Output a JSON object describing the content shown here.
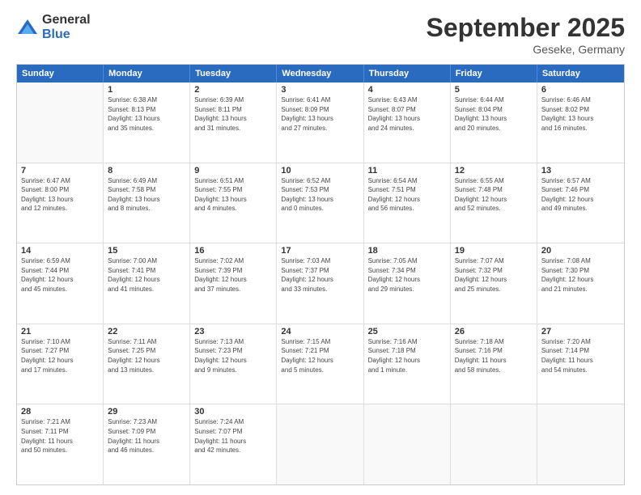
{
  "logo": {
    "general": "General",
    "blue": "Blue"
  },
  "title": {
    "month": "September 2025",
    "location": "Geseke, Germany"
  },
  "header": {
    "days": [
      "Sunday",
      "Monday",
      "Tuesday",
      "Wednesday",
      "Thursday",
      "Friday",
      "Saturday"
    ]
  },
  "weeks": [
    [
      {
        "day": "",
        "empty": true
      },
      {
        "day": "1",
        "info": "Sunrise: 6:38 AM\nSunset: 8:13 PM\nDaylight: 13 hours\nand 35 minutes."
      },
      {
        "day": "2",
        "info": "Sunrise: 6:39 AM\nSunset: 8:11 PM\nDaylight: 13 hours\nand 31 minutes."
      },
      {
        "day": "3",
        "info": "Sunrise: 6:41 AM\nSunset: 8:09 PM\nDaylight: 13 hours\nand 27 minutes."
      },
      {
        "day": "4",
        "info": "Sunrise: 6:43 AM\nSunset: 8:07 PM\nDaylight: 13 hours\nand 24 minutes."
      },
      {
        "day": "5",
        "info": "Sunrise: 6:44 AM\nSunset: 8:04 PM\nDaylight: 13 hours\nand 20 minutes."
      },
      {
        "day": "6",
        "info": "Sunrise: 6:46 AM\nSunset: 8:02 PM\nDaylight: 13 hours\nand 16 minutes."
      }
    ],
    [
      {
        "day": "7",
        "info": "Sunrise: 6:47 AM\nSunset: 8:00 PM\nDaylight: 13 hours\nand 12 minutes."
      },
      {
        "day": "8",
        "info": "Sunrise: 6:49 AM\nSunset: 7:58 PM\nDaylight: 13 hours\nand 8 minutes."
      },
      {
        "day": "9",
        "info": "Sunrise: 6:51 AM\nSunset: 7:55 PM\nDaylight: 13 hours\nand 4 minutes."
      },
      {
        "day": "10",
        "info": "Sunrise: 6:52 AM\nSunset: 7:53 PM\nDaylight: 13 hours\nand 0 minutes."
      },
      {
        "day": "11",
        "info": "Sunrise: 6:54 AM\nSunset: 7:51 PM\nDaylight: 12 hours\nand 56 minutes."
      },
      {
        "day": "12",
        "info": "Sunrise: 6:55 AM\nSunset: 7:48 PM\nDaylight: 12 hours\nand 52 minutes."
      },
      {
        "day": "13",
        "info": "Sunrise: 6:57 AM\nSunset: 7:46 PM\nDaylight: 12 hours\nand 49 minutes."
      }
    ],
    [
      {
        "day": "14",
        "info": "Sunrise: 6:59 AM\nSunset: 7:44 PM\nDaylight: 12 hours\nand 45 minutes."
      },
      {
        "day": "15",
        "info": "Sunrise: 7:00 AM\nSunset: 7:41 PM\nDaylight: 12 hours\nand 41 minutes."
      },
      {
        "day": "16",
        "info": "Sunrise: 7:02 AM\nSunset: 7:39 PM\nDaylight: 12 hours\nand 37 minutes."
      },
      {
        "day": "17",
        "info": "Sunrise: 7:03 AM\nSunset: 7:37 PM\nDaylight: 12 hours\nand 33 minutes."
      },
      {
        "day": "18",
        "info": "Sunrise: 7:05 AM\nSunset: 7:34 PM\nDaylight: 12 hours\nand 29 minutes."
      },
      {
        "day": "19",
        "info": "Sunrise: 7:07 AM\nSunset: 7:32 PM\nDaylight: 12 hours\nand 25 minutes."
      },
      {
        "day": "20",
        "info": "Sunrise: 7:08 AM\nSunset: 7:30 PM\nDaylight: 12 hours\nand 21 minutes."
      }
    ],
    [
      {
        "day": "21",
        "info": "Sunrise: 7:10 AM\nSunset: 7:27 PM\nDaylight: 12 hours\nand 17 minutes."
      },
      {
        "day": "22",
        "info": "Sunrise: 7:11 AM\nSunset: 7:25 PM\nDaylight: 12 hours\nand 13 minutes."
      },
      {
        "day": "23",
        "info": "Sunrise: 7:13 AM\nSunset: 7:23 PM\nDaylight: 12 hours\nand 9 minutes."
      },
      {
        "day": "24",
        "info": "Sunrise: 7:15 AM\nSunset: 7:21 PM\nDaylight: 12 hours\nand 5 minutes."
      },
      {
        "day": "25",
        "info": "Sunrise: 7:16 AM\nSunset: 7:18 PM\nDaylight: 12 hours\nand 1 minute."
      },
      {
        "day": "26",
        "info": "Sunrise: 7:18 AM\nSunset: 7:16 PM\nDaylight: 11 hours\nand 58 minutes."
      },
      {
        "day": "27",
        "info": "Sunrise: 7:20 AM\nSunset: 7:14 PM\nDaylight: 11 hours\nand 54 minutes."
      }
    ],
    [
      {
        "day": "28",
        "info": "Sunrise: 7:21 AM\nSunset: 7:11 PM\nDaylight: 11 hours\nand 50 minutes."
      },
      {
        "day": "29",
        "info": "Sunrise: 7:23 AM\nSunset: 7:09 PM\nDaylight: 11 hours\nand 46 minutes."
      },
      {
        "day": "30",
        "info": "Sunrise: 7:24 AM\nSunset: 7:07 PM\nDaylight: 11 hours\nand 42 minutes."
      },
      {
        "day": "",
        "empty": true
      },
      {
        "day": "",
        "empty": true
      },
      {
        "day": "",
        "empty": true
      },
      {
        "day": "",
        "empty": true
      }
    ]
  ]
}
